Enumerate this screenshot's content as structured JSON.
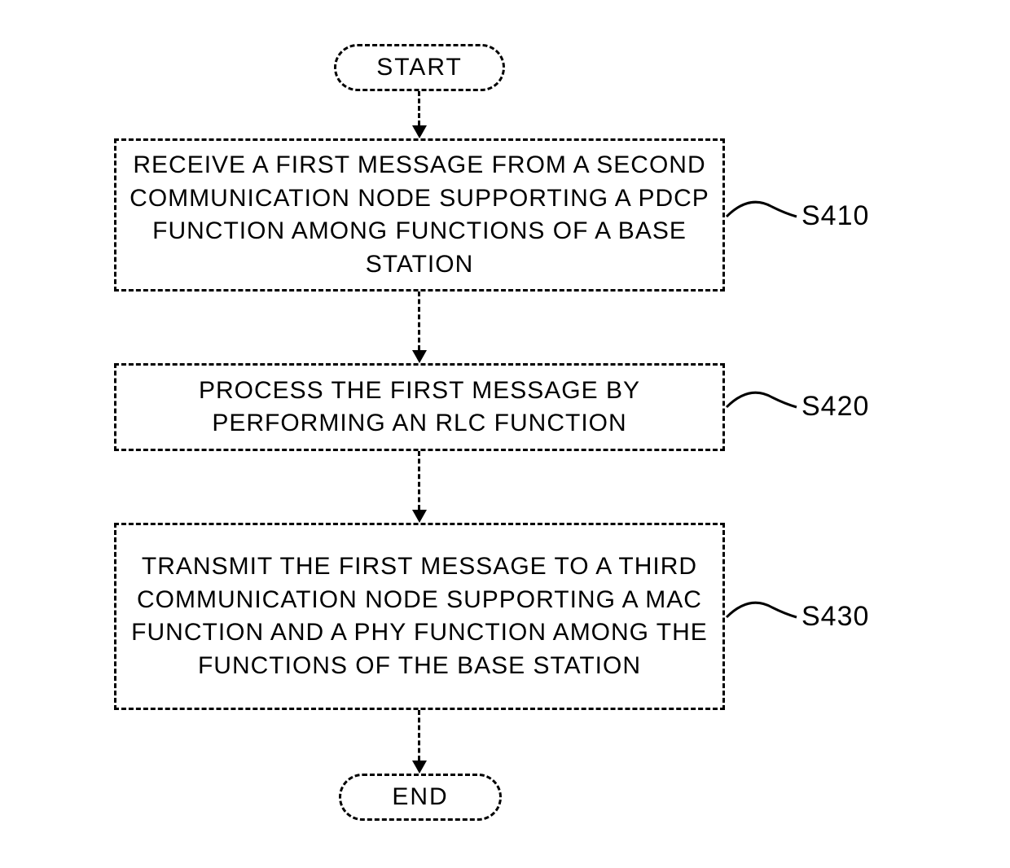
{
  "flowchart": {
    "start": "START",
    "end": "END",
    "steps": [
      {
        "id": "S410",
        "text": "RECEIVE A FIRST MESSAGE FROM A SECOND COMMUNICATION NODE SUPPORTING A PDCP FUNCTION AMONG FUNCTIONS OF A BASE STATION"
      },
      {
        "id": "S420",
        "text": "PROCESS THE FIRST MESSAGE BY PERFORMING AN RLC FUNCTION"
      },
      {
        "id": "S430",
        "text": "TRANSMIT THE FIRST MESSAGE TO A THIRD COMMUNICATION NODE SUPPORTING A MAC FUNCTION AND A PHY FUNCTION AMONG THE FUNCTIONS OF THE BASE STATION"
      }
    ]
  }
}
